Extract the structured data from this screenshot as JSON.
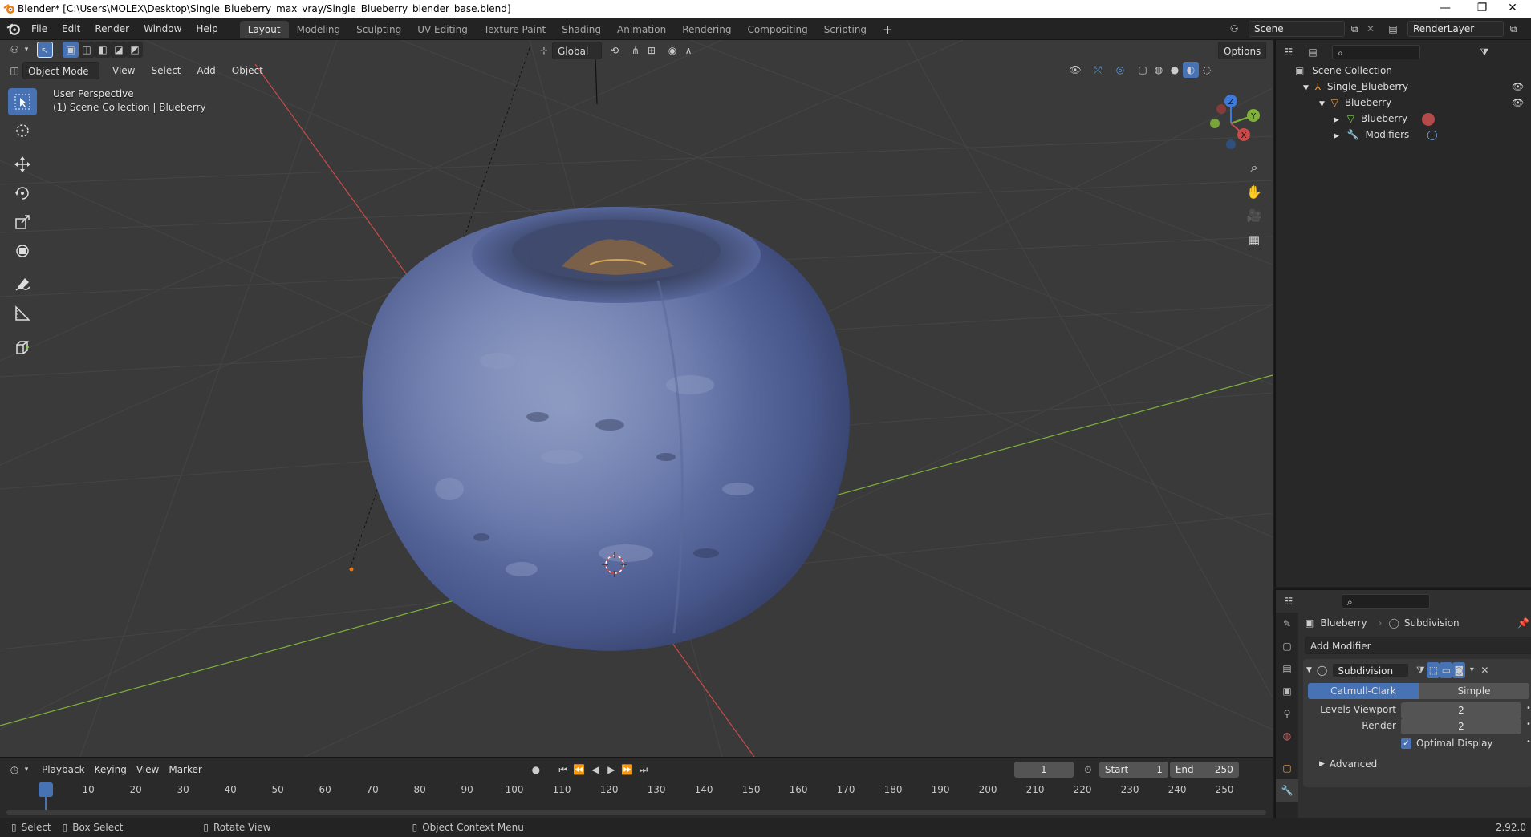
{
  "window": {
    "title": "Blender* [C:\\Users\\MOLEX\\Desktop\\Single_Blueberry_max_vray/Single_Blueberry_blender_base.blend]",
    "minimize": "—",
    "maximize": "❐",
    "close": "✕"
  },
  "menu": [
    "File",
    "Edit",
    "Render",
    "Window",
    "Help"
  ],
  "workspaces": [
    "Layout",
    "Modeling",
    "Sculpting",
    "UV Editing",
    "Texture Paint",
    "Shading",
    "Animation",
    "Rendering",
    "Compositing",
    "Scripting"
  ],
  "workspace_add": "+",
  "scene": {
    "name": "Scene",
    "render_layer": "RenderLayer"
  },
  "viewport": {
    "mode": "Object Mode",
    "menus": [
      "View",
      "Select",
      "Add",
      "Object"
    ],
    "transform_orientation": "Global",
    "options_label": "Options",
    "perspective": "User Perspective",
    "collection_info": "(1) Scene Collection | Blueberry",
    "gizmo_axes": {
      "x": "X",
      "y": "Y",
      "z": "Z"
    }
  },
  "outliner": {
    "rows": [
      {
        "label": "Scene Collection"
      },
      {
        "label": "Single_Blueberry"
      },
      {
        "label": "Blueberry"
      },
      {
        "label": "Blueberry"
      },
      {
        "label": "Modifiers"
      }
    ]
  },
  "properties": {
    "object_name": "Blueberry",
    "modifier_crumb": "Subdivision",
    "add_modifier": "Add Modifier",
    "modifier_name": "Subdivision",
    "method_options": [
      "Catmull-Clark",
      "Simple"
    ],
    "levels_viewport_label": "Levels Viewport",
    "levels_viewport_value": "2",
    "render_label": "Render",
    "render_value": "2",
    "optimal_display_label": "Optimal Display",
    "optimal_display_checked": true,
    "advanced_label": "Advanced"
  },
  "timeline": {
    "menus": [
      "Playback",
      "Keying",
      "View",
      "Marker"
    ],
    "current_frame": "1",
    "start_label": "Start",
    "start_value": "1",
    "end_label": "End",
    "end_value": "250",
    "ticks": [
      "1",
      "10",
      "20",
      "30",
      "40",
      "50",
      "60",
      "70",
      "80",
      "90",
      "100",
      "110",
      "120",
      "130",
      "140",
      "150",
      "160",
      "170",
      "180",
      "190",
      "200",
      "210",
      "220",
      "230",
      "240",
      "250"
    ]
  },
  "statusbar": {
    "select": "Select",
    "box_select": "Box Select",
    "rotate_view": "Rotate View",
    "context_menu": "Object Context Menu",
    "version": "2.92.0"
  },
  "colors": {
    "accent": "#4772b3",
    "x_axis": "#c94a4a",
    "y_axis": "#7fb03a",
    "z_axis": "#3d7ad9"
  }
}
